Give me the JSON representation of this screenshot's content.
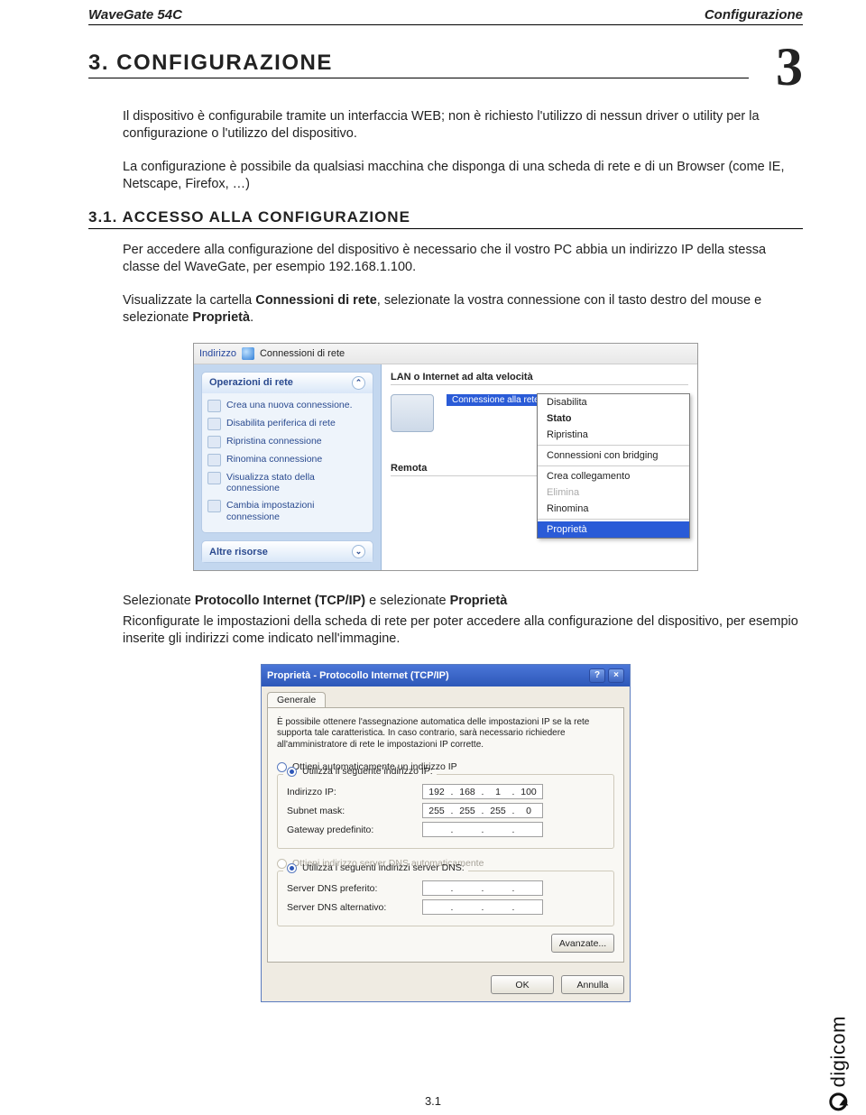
{
  "header": {
    "left": "WaveGate 54C",
    "right": "Configurazione"
  },
  "chapter": {
    "num": "3",
    "title": "3.   CONFIGURAZIONE"
  },
  "intro1": "Il dispositivo è configurabile tramite un interfaccia WEB; non è richiesto l'utilizzo di nessun driver o utility per la configurazione o l'utilizzo del dispositivo.",
  "intro2": "La configurazione è possibile da qualsiasi macchina che disponga di una scheda di rete e di un Browser (come IE, Netscape, Firefox, …)",
  "sub": "3.1.    ACCESSO ALLA CONFIGURAZIONE",
  "p1": "Per accedere alla configurazione del dispositivo è necessario che il vostro PC abbia un indirizzo IP della stessa classe del WaveGate, per esempio 192.168.1.100.",
  "p2a": "Visualizzate la cartella ",
  "p2b": "Connessioni di rete",
  "p2c": ", selezionate la vostra connessione con il tasto destro del mouse e selezionate ",
  "p2d": "Proprietà",
  "p2e": ".",
  "shot1": {
    "address_label": "Indirizzo",
    "address_value": "Connessioni di rete",
    "panel1_title": "Operazioni di rete",
    "panel1_items": [
      "Crea una nuova connessione.",
      "Disabilita periferica di rete",
      "Ripristina connessione",
      "Rinomina connessione",
      "Visualizza stato della connessione",
      "Cambia impostazioni connessione"
    ],
    "panel2_title": "Altre risorse",
    "lan_header": "LAN o Internet ad alta velocità",
    "selected": "Connessione alla rete locale (LAN)",
    "remota": "Remota",
    "ctx": [
      "Disabilita",
      "Stato",
      "Ripristina",
      "Connessioni con bridging",
      "Crea collegamento",
      "Elimina",
      "Rinomina",
      "Proprietà"
    ]
  },
  "mid1a": "Selezionate ",
  "mid1b": "Protocollo Internet (TCP/IP)",
  "mid1c": " e selezionate ",
  "mid1d": "Proprietà",
  "mid2": "Riconfigurate le impostazioni della scheda di rete per poter accedere alla configurazione del dispositivo, per esempio inserite gli indirizzi come indicato nell'immagine.",
  "shot2": {
    "title": "Proprietà - Protocollo Internet (TCP/IP)",
    "tab": "Generale",
    "desc": "È possibile ottenere l'assegnazione automatica delle impostazioni IP se la rete supporta tale caratteristica. In caso contrario, sarà necessario richiedere all'amministratore di rete le impostazioni IP corrette.",
    "r1": "Ottieni automaticamente un indirizzo IP",
    "r2": "Utilizza il seguente indirizzo IP:",
    "ip_label": "Indirizzo IP:",
    "ip": [
      "192",
      "168",
      "1",
      "100"
    ],
    "mask_label": "Subnet mask:",
    "mask": [
      "255",
      "255",
      "255",
      "0"
    ],
    "gw_label": "Gateway predefinito:",
    "r3": "Ottieni indirizzo server DNS automaticamente",
    "r4": "Utilizza i seguenti indirizzi server DNS:",
    "dns1_label": "Server DNS preferito:",
    "dns2_label": "Server DNS alternativo:",
    "adv": "Avanzate...",
    "ok": "OK",
    "cancel": "Annulla"
  },
  "brand": "digicom",
  "page_num": "3.1"
}
